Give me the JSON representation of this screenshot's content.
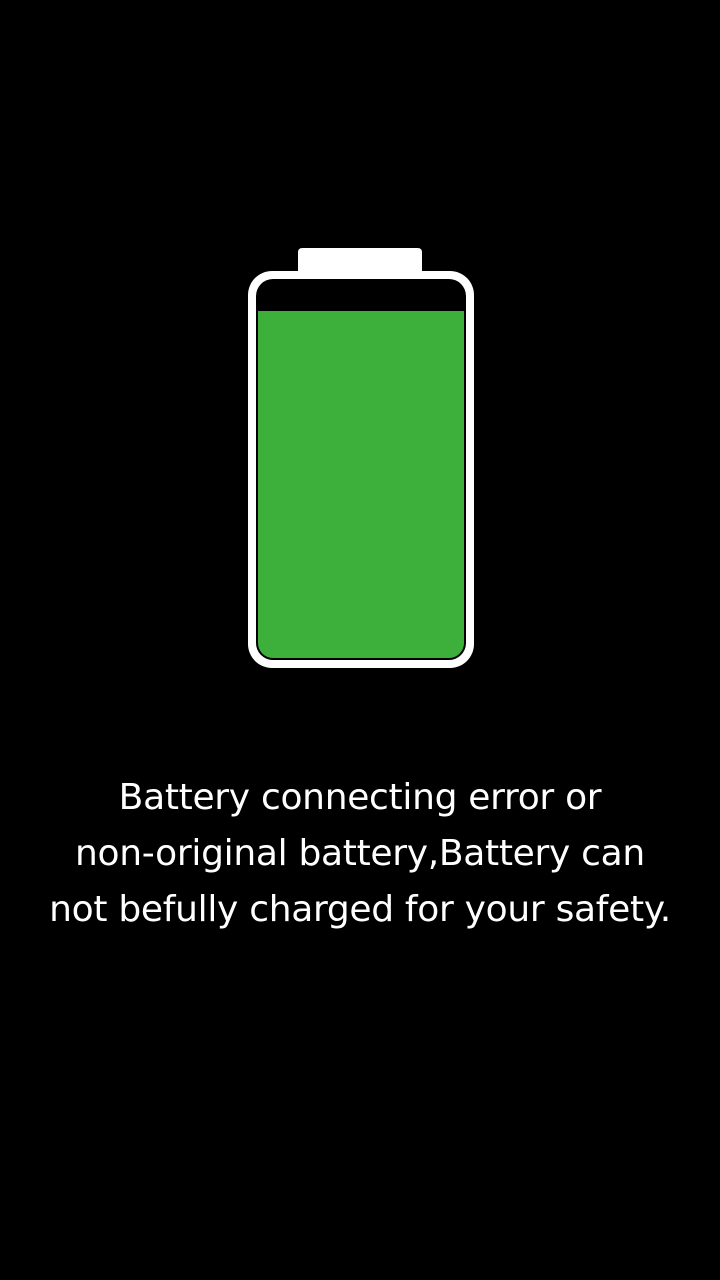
{
  "battery": {
    "level": 0.92,
    "fill_color": "#3db03b",
    "outline_color": "#ffffff",
    "icon": "battery-icon"
  },
  "message": {
    "lines": [
      "Battery connecting error or",
      "non-original battery,Battery can",
      "not befully charged for your safety."
    ]
  }
}
